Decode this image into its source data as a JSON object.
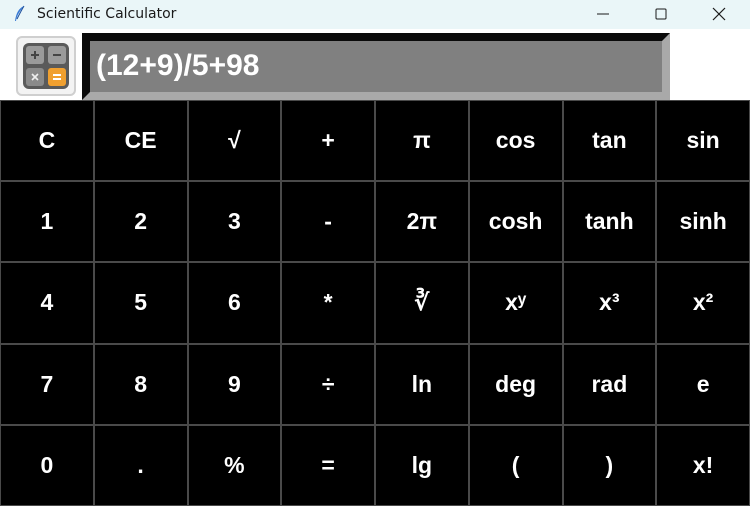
{
  "window": {
    "title": "Scientific Calculator",
    "icon": "feather-icon",
    "controls": [
      "minimize-icon",
      "maximize-icon",
      "close-icon"
    ]
  },
  "app_icon": "calculator-icon",
  "display": {
    "value": "(12+9)/5+98",
    "background": "#808080",
    "text_color": "#ffffff"
  },
  "colors": {
    "key_background": "#000000",
    "key_text": "#ffffff",
    "key_border": "#4a4a4a",
    "titlebar": "#eaf6f8"
  },
  "keys": [
    [
      "C",
      "CE",
      "√",
      "+",
      "π",
      "cos",
      "tan",
      "sin"
    ],
    [
      "1",
      "2",
      "3",
      "-",
      "2π",
      "cosh",
      "tanh",
      "sinh"
    ],
    [
      "4",
      "5",
      "6",
      "*",
      "∛",
      "xʸ",
      "x³",
      "x²"
    ],
    [
      "7",
      "8",
      "9",
      "÷",
      "ln",
      "deg",
      "rad",
      "e"
    ],
    [
      "0",
      ".",
      "%",
      "=",
      "lg",
      "(",
      ")",
      "x!"
    ]
  ]
}
